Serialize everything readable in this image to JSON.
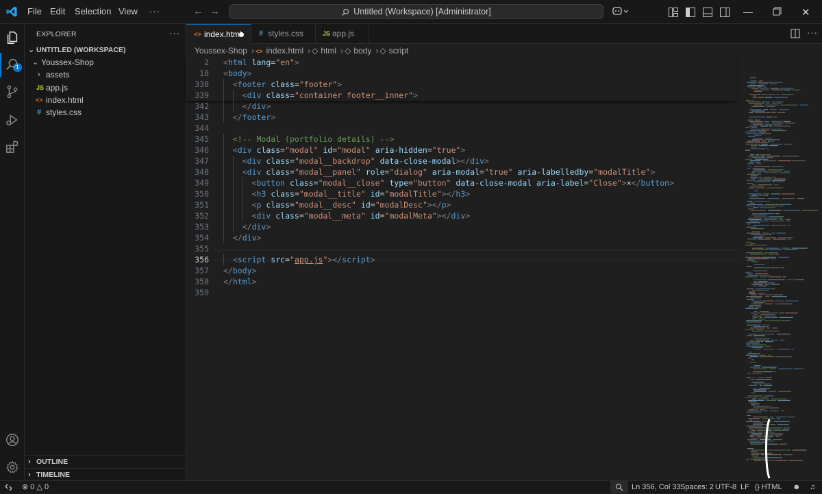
{
  "titlebar": {
    "menu": [
      "File",
      "Edit",
      "Selection",
      "View",
      "···"
    ],
    "title": "Untitled (Workspace) [Administrator]"
  },
  "activity": {
    "explorer_badge": "1"
  },
  "sidebar": {
    "title": "EXPLORER",
    "more": "···",
    "workspace": "UNTITLED (WORKSPACE)",
    "folder": "Youssex-Shop",
    "items": [
      {
        "label": "assets",
        "kind": "folder",
        "icon": ""
      },
      {
        "label": "app.js",
        "kind": "js",
        "icon": "JS"
      },
      {
        "label": "index.html",
        "kind": "html",
        "icon": "<>"
      },
      {
        "label": "styles.css",
        "kind": "css",
        "icon": "#"
      }
    ],
    "outline": "OUTLINE",
    "timeline": "TIMELINE"
  },
  "tabs": [
    {
      "label": "index.html",
      "icon": "<>",
      "kind": "html",
      "active": true,
      "dirty": true
    },
    {
      "label": "styles.css",
      "icon": "#",
      "kind": "css",
      "active": false
    },
    {
      "label": "app.js",
      "icon": "JS",
      "kind": "js",
      "active": false
    }
  ],
  "editor_more": "···",
  "breadcrumb": [
    "Youssex-Shop",
    "index.html",
    "html",
    "body",
    "script"
  ],
  "sticky_lines": [
    {
      "n": "2",
      "indent": 0,
      "tokens": [
        [
          "br",
          "<"
        ],
        [
          "tag",
          "html"
        ],
        [
          "txt",
          " "
        ],
        [
          "attr",
          "lang"
        ],
        [
          "txt",
          "="
        ],
        [
          "str",
          "\"en\""
        ],
        [
          "br",
          ">"
        ]
      ]
    },
    {
      "n": "18",
      "indent": 0,
      "tokens": [
        [
          "br",
          "<"
        ],
        [
          "tag",
          "body"
        ],
        [
          "br",
          ">"
        ]
      ]
    },
    {
      "n": "338",
      "indent": 1,
      "tokens": [
        [
          "br",
          "<"
        ],
        [
          "tag",
          "footer"
        ],
        [
          "txt",
          " "
        ],
        [
          "attr",
          "class"
        ],
        [
          "txt",
          "="
        ],
        [
          "str",
          "\"footer\""
        ],
        [
          "br",
          ">"
        ]
      ]
    },
    {
      "n": "339",
      "indent": 2,
      "tokens": [
        [
          "br",
          "<"
        ],
        [
          "tag",
          "div"
        ],
        [
          "txt",
          " "
        ],
        [
          "attr",
          "class"
        ],
        [
          "txt",
          "="
        ],
        [
          "str",
          "\"container footer__inner\""
        ],
        [
          "br",
          ">"
        ]
      ]
    }
  ],
  "code_lines": [
    {
      "n": "342",
      "indent": 2,
      "tokens": [
        [
          "br",
          "</"
        ],
        [
          "tag",
          "div"
        ],
        [
          "br",
          ">"
        ]
      ]
    },
    {
      "n": "343",
      "indent": 1,
      "tokens": [
        [
          "br",
          "</"
        ],
        [
          "tag",
          "footer"
        ],
        [
          "br",
          ">"
        ]
      ]
    },
    {
      "n": "344",
      "indent": 0,
      "tokens": []
    },
    {
      "n": "345",
      "indent": 1,
      "tokens": [
        [
          "cmt",
          "<!-- Modal (portfolio details) -->"
        ]
      ]
    },
    {
      "n": "346",
      "indent": 1,
      "tokens": [
        [
          "br",
          "<"
        ],
        [
          "tag",
          "div"
        ],
        [
          "txt",
          " "
        ],
        [
          "attr",
          "class"
        ],
        [
          "txt",
          "="
        ],
        [
          "str",
          "\"modal\""
        ],
        [
          "txt",
          " "
        ],
        [
          "attr",
          "id"
        ],
        [
          "txt",
          "="
        ],
        [
          "str",
          "\"modal\""
        ],
        [
          "txt",
          " "
        ],
        [
          "attr",
          "aria-hidden"
        ],
        [
          "txt",
          "="
        ],
        [
          "str",
          "\"true\""
        ],
        [
          "br",
          ">"
        ]
      ]
    },
    {
      "n": "347",
      "indent": 2,
      "tokens": [
        [
          "br",
          "<"
        ],
        [
          "tag",
          "div"
        ],
        [
          "txt",
          " "
        ],
        [
          "attr",
          "class"
        ],
        [
          "txt",
          "="
        ],
        [
          "str",
          "\"modal__backdrop\""
        ],
        [
          "txt",
          " "
        ],
        [
          "attr",
          "data-close-modal"
        ],
        [
          "br",
          "></"
        ],
        [
          "tag",
          "div"
        ],
        [
          "br",
          ">"
        ]
      ]
    },
    {
      "n": "348",
      "indent": 2,
      "tokens": [
        [
          "br",
          "<"
        ],
        [
          "tag",
          "div"
        ],
        [
          "txt",
          " "
        ],
        [
          "attr",
          "class"
        ],
        [
          "txt",
          "="
        ],
        [
          "str",
          "\"modal__panel\""
        ],
        [
          "txt",
          " "
        ],
        [
          "attr",
          "role"
        ],
        [
          "txt",
          "="
        ],
        [
          "str",
          "\"dialog\""
        ],
        [
          "txt",
          " "
        ],
        [
          "attr",
          "aria-modal"
        ],
        [
          "txt",
          "="
        ],
        [
          "str",
          "\"true\""
        ],
        [
          "txt",
          " "
        ],
        [
          "attr",
          "aria-labelledby"
        ],
        [
          "txt",
          "="
        ],
        [
          "str",
          "\"modalTitle\""
        ],
        [
          "br",
          ">"
        ]
      ]
    },
    {
      "n": "349",
      "indent": 3,
      "tokens": [
        [
          "br",
          "<"
        ],
        [
          "tag",
          "button"
        ],
        [
          "txt",
          " "
        ],
        [
          "attr",
          "class"
        ],
        [
          "txt",
          "="
        ],
        [
          "str",
          "\"modal__close\""
        ],
        [
          "txt",
          " "
        ],
        [
          "attr",
          "type"
        ],
        [
          "txt",
          "="
        ],
        [
          "str",
          "\"button\""
        ],
        [
          "txt",
          " "
        ],
        [
          "attr",
          "data-close-modal"
        ],
        [
          "txt",
          " "
        ],
        [
          "attr",
          "aria-label"
        ],
        [
          "txt",
          "="
        ],
        [
          "str",
          "\"Close\""
        ],
        [
          "br",
          ">"
        ],
        [
          "txt",
          "×"
        ],
        [
          "br",
          "</"
        ],
        [
          "tag",
          "button"
        ],
        [
          "br",
          ">"
        ]
      ]
    },
    {
      "n": "350",
      "indent": 3,
      "tokens": [
        [
          "br",
          "<"
        ],
        [
          "tag",
          "h3"
        ],
        [
          "txt",
          " "
        ],
        [
          "attr",
          "class"
        ],
        [
          "txt",
          "="
        ],
        [
          "str",
          "\"modal__title\""
        ],
        [
          "txt",
          " "
        ],
        [
          "attr",
          "id"
        ],
        [
          "txt",
          "="
        ],
        [
          "str",
          "\"modalTitle\""
        ],
        [
          "br",
          "></"
        ],
        [
          "tag",
          "h3"
        ],
        [
          "br",
          ">"
        ]
      ]
    },
    {
      "n": "351",
      "indent": 3,
      "tokens": [
        [
          "br",
          "<"
        ],
        [
          "tag",
          "p"
        ],
        [
          "txt",
          " "
        ],
        [
          "attr",
          "class"
        ],
        [
          "txt",
          "="
        ],
        [
          "str",
          "\"modal__desc\""
        ],
        [
          "txt",
          " "
        ],
        [
          "attr",
          "id"
        ],
        [
          "txt",
          "="
        ],
        [
          "str",
          "\"modalDesc\""
        ],
        [
          "br",
          "></"
        ],
        [
          "tag",
          "p"
        ],
        [
          "br",
          ">"
        ]
      ]
    },
    {
      "n": "352",
      "indent": 3,
      "tokens": [
        [
          "br",
          "<"
        ],
        [
          "tag",
          "div"
        ],
        [
          "txt",
          " "
        ],
        [
          "attr",
          "class"
        ],
        [
          "txt",
          "="
        ],
        [
          "str",
          "\"modal__meta\""
        ],
        [
          "txt",
          " "
        ],
        [
          "attr",
          "id"
        ],
        [
          "txt",
          "="
        ],
        [
          "str",
          "\"modalMeta\""
        ],
        [
          "br",
          "></"
        ],
        [
          "tag",
          "div"
        ],
        [
          "br",
          ">"
        ]
      ]
    },
    {
      "n": "353",
      "indent": 2,
      "tokens": [
        [
          "br",
          "</"
        ],
        [
          "tag",
          "div"
        ],
        [
          "br",
          ">"
        ]
      ]
    },
    {
      "n": "354",
      "indent": 1,
      "tokens": [
        [
          "br",
          "</"
        ],
        [
          "tag",
          "div"
        ],
        [
          "br",
          ">"
        ]
      ]
    },
    {
      "n": "355",
      "indent": 0,
      "tokens": []
    },
    {
      "n": "356",
      "indent": 1,
      "current": true,
      "tokens": [
        [
          "br",
          "<"
        ],
        [
          "tag",
          "script"
        ],
        [
          "txt",
          " "
        ],
        [
          "attr",
          "src"
        ],
        [
          "txt",
          "="
        ],
        [
          "str",
          "\""
        ],
        [
          "strul",
          "app.js"
        ],
        [
          "str",
          "\""
        ],
        [
          "br",
          "></"
        ],
        [
          "tag",
          "script"
        ],
        [
          "br",
          ">"
        ]
      ]
    },
    {
      "n": "357",
      "indent": 0,
      "tokens": [
        [
          "br",
          "</"
        ],
        [
          "tag",
          "body"
        ],
        [
          "br",
          ">"
        ]
      ]
    },
    {
      "n": "358",
      "indent": 0,
      "tokens": [
        [
          "br",
          "</"
        ],
        [
          "tag",
          "html"
        ],
        [
          "br",
          ">"
        ]
      ]
    },
    {
      "n": "359",
      "indent": 0,
      "tokens": []
    }
  ],
  "statusbar": {
    "errors": "0",
    "warnings": "0",
    "position": "Ln 356, Col 33",
    "spaces": "Spaces: 2",
    "encoding": "UTF-8",
    "eol": "LF",
    "language": "HTML"
  },
  "colors": {
    "accent": "#0078d4",
    "tag": "#569cd6",
    "attr": "#9cdcfe",
    "string": "#ce9178",
    "comment": "#6a9955",
    "bracket": "#808080",
    "html_icon": "#e37933",
    "css_icon": "#519aba",
    "js_icon": "#cbcb41"
  }
}
